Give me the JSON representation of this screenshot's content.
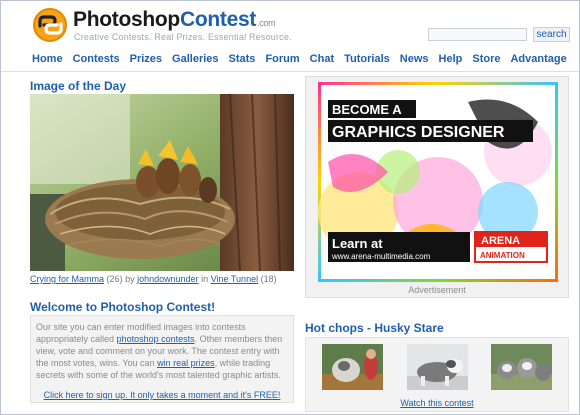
{
  "header": {
    "logo_part1": "Photoshop",
    "logo_part2": "Contest",
    "logo_suffix": ".com",
    "tagline": "Creative Contests. Real Prizes. Essential Resource.",
    "search_button": "search",
    "search_value": ""
  },
  "nav": {
    "items": [
      "Home",
      "Contests",
      "Prizes",
      "Galleries",
      "Stats",
      "Forum",
      "Chat",
      "Tutorials",
      "News",
      "Help",
      "Store",
      "Advantage"
    ]
  },
  "iotd": {
    "title": "Image of the Day",
    "image_name": "Crying for Mamma",
    "count": "(26)",
    "by": "by",
    "author": "johndownunder",
    "in": "in",
    "gallery": "Vine Tunnel",
    "gallery_count": "(18)"
  },
  "welcome": {
    "title": "Welcome to Photoshop Contest!",
    "text_1": "Our site you can enter modified images into contests appropriately called ",
    "link_1": "photoshop contests",
    "text_2": ". Other members then view, vote and comment on your work. The contest entry with the most votes, wins. You can ",
    "link_2": "win real prizes",
    "text_3": ", while trading secrets with some of the world's most talented graphic artists.",
    "signup": "Click here to sign up. It only takes a moment and it's FREE!"
  },
  "ad": {
    "headline_1": "BECOME A",
    "headline_2": "GRAPHICS DESIGNER",
    "learn_at": "Learn at",
    "url": "www.arena-multimedia.com",
    "brand_1": "ARENA",
    "brand_2": "ANIMATION",
    "label": "Advertisement"
  },
  "hot": {
    "title": "Hot chops - Husky Stare",
    "watch": "Watch this contest"
  },
  "colors": {
    "link_blue": "#1f5fae",
    "logo_orange": "#f7a21b",
    "ad_red": "#e2231a"
  }
}
